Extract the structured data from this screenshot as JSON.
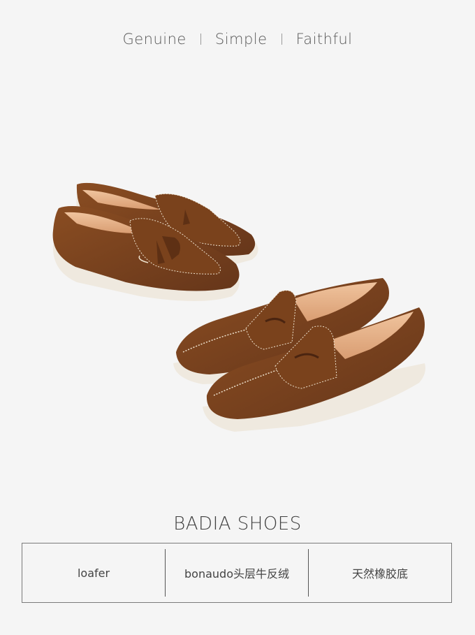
{
  "tagline": {
    "word1": "Genuine",
    "word2": "Simple",
    "word3": "Faithful"
  },
  "product_image": {
    "subject": "two pairs of brown suede loafers with white soles",
    "colors": {
      "suede": "#7a421c",
      "suede_dark": "#5e3014",
      "lining": "#e8b48c",
      "sole": "#efe9df",
      "stitch": "#efe3cf"
    }
  },
  "brand_title": "BADIA SHOES",
  "specs": [
    {
      "label": "loafer"
    },
    {
      "label": "bonaudo头层牛反绒"
    },
    {
      "label": "天然橡胶底"
    }
  ]
}
